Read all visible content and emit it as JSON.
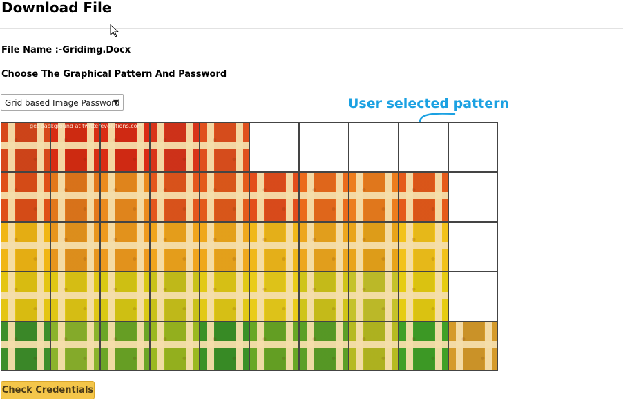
{
  "page": {
    "title": "Download File"
  },
  "file": {
    "label": "File Name :-Gridimg.Docx"
  },
  "instructions": {
    "text": "Choose The Graphical Pattern And Password"
  },
  "password_type": {
    "selected": "Grid based Image Password",
    "caret_icon": "triangle-down-icon"
  },
  "annotation": {
    "text": "User selected pattern",
    "color": "#1ba1e2",
    "arrow_icon": "curved-arrow-down-icon"
  },
  "image": {
    "watermark": "get background at twitterevolutions.com"
  },
  "grid": {
    "rows": 5,
    "columns": 10,
    "cells": [
      [
        "#d7471a",
        "#d82c12",
        "#da2b14",
        "#d8341a",
        "#e0501d",
        "",
        "",
        "",
        "",
        ""
      ],
      [
        "#df4f18",
        "#e3781b",
        "#eb8b1e",
        "#e3561c",
        "#e35b1b",
        "#e34e1c",
        "#eb6b1c",
        "#ec7d1e",
        "#e55a1a",
        ""
      ],
      [
        "#f0b614",
        "#e8951d",
        "#ee9a1e",
        "#f0a51c",
        "#efa81c",
        "#f0b81a",
        "#eda61e",
        "#e9a41a",
        "#f2c21a",
        ""
      ],
      [
        "#e4c512",
        "#e0c715",
        "#d9c914",
        "#c9c21a",
        "#e2c916",
        "#e9cc1a",
        "#cfc41a",
        "#c5c22a",
        "#e6cc12",
        ""
      ],
      [
        "#3d8e2a",
        "#8bb32c",
        "#6ba626",
        "#9bb820",
        "#3a9127",
        "#68a725",
        "#5a9f27",
        "#b6ba21",
        "#3fa027",
        "#d59a2a"
      ]
    ]
  },
  "actions": {
    "check_credentials": "Check Credentials"
  }
}
